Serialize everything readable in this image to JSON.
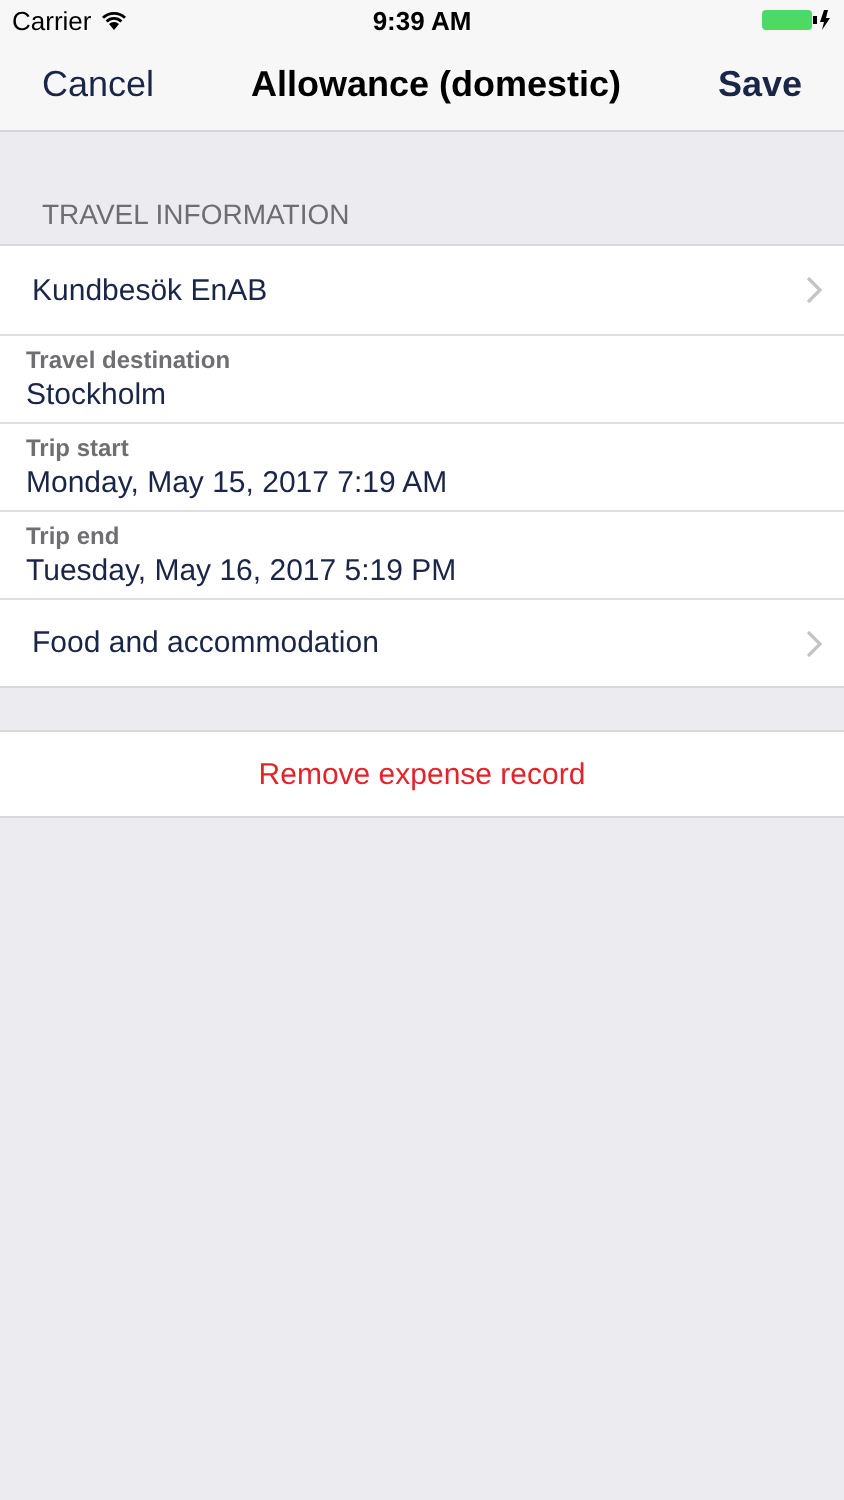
{
  "status_bar": {
    "carrier": "Carrier",
    "time": "9:39 AM"
  },
  "nav_bar": {
    "left_button": "Cancel",
    "title": "Allowance (domestic)",
    "right_button": "Save"
  },
  "section": {
    "header": "TRAVEL INFORMATION",
    "rows": [
      {
        "kind": "link",
        "label": "Kundbesök EnAB"
      },
      {
        "kind": "field",
        "label": "Travel destination",
        "value": "Stockholm"
      },
      {
        "kind": "field",
        "label": "Trip start",
        "value": "Monday, May 15, 2017 7:19 AM"
      },
      {
        "kind": "field",
        "label": "Trip end",
        "value": "Tuesday, May 16, 2017 5:19 PM"
      },
      {
        "kind": "link",
        "label": "Food and accommodation"
      }
    ]
  },
  "remove_button": "Remove expense record"
}
